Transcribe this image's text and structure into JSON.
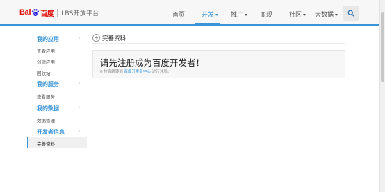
{
  "header": {
    "logo": {
      "brand_latin": "Bai",
      "brand_cn": "百度",
      "product": "LBS开放平台"
    },
    "nav": [
      {
        "label": "首页",
        "has_dropdown": false,
        "active": false
      },
      {
        "label": "开发",
        "has_dropdown": true,
        "active": true
      },
      {
        "label": "推广",
        "has_dropdown": true,
        "active": false
      },
      {
        "label": "变现",
        "has_dropdown": false,
        "active": false
      },
      {
        "label": "社区",
        "has_dropdown": true,
        "active": false
      },
      {
        "label": "大数据",
        "has_dropdown": true,
        "active": false
      }
    ],
    "search_icon": "search-icon"
  },
  "sidebar": {
    "groups": [
      {
        "title": "我的应用",
        "items": [
          "查看应用",
          "创建应用",
          "回收站"
        ]
      },
      {
        "title": "我的服务",
        "items": [
          "查看服务"
        ]
      },
      {
        "title": "我的数据",
        "items": [
          "数据管理"
        ]
      },
      {
        "title": "开发者信息",
        "items": [
          "完善资料"
        ]
      }
    ],
    "active_item": "完善资料"
  },
  "main": {
    "page_title": "完善资料",
    "notice": {
      "title": "请先注册成为百度开发者！",
      "desc_prefix": "0 秒后跳转到 ",
      "desc_link": "百度开发者中心",
      "desc_suffix": " 进行注册。"
    }
  },
  "colors": {
    "accent": "#3a95d8",
    "brand_red": "#e10602",
    "topbar_bg": "#f7f7f7",
    "notice_bg": "#f7f7f7"
  }
}
